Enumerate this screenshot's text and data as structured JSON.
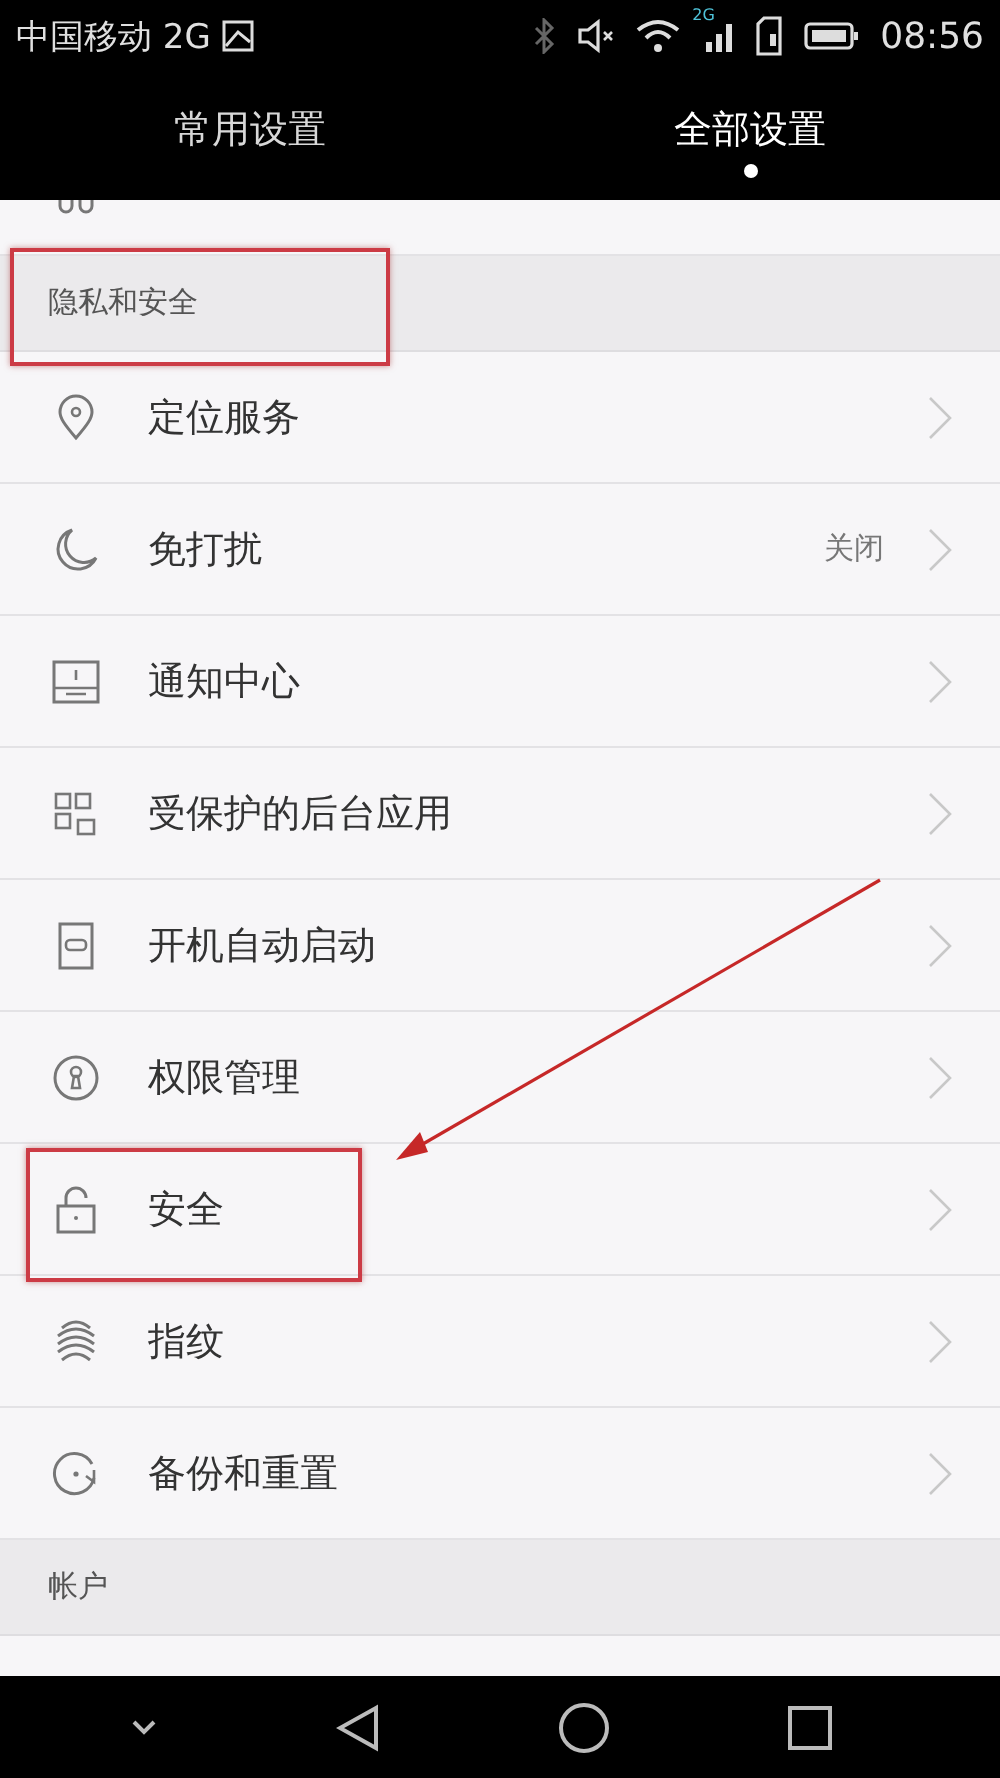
{
  "status_bar": {
    "carrier": "中国移动 2G",
    "network_badge": "2G",
    "time": "08:56"
  },
  "tabs": [
    {
      "label": "常用设置",
      "selected": false
    },
    {
      "label": "全部设置",
      "selected": true
    }
  ],
  "sections": [
    {
      "kind": "partial",
      "items": [
        {
          "kind": "steps"
        }
      ]
    },
    {
      "kind": "full",
      "title": "隐私和安全",
      "highlighted": true,
      "items": [
        {
          "kind": "location",
          "label": "定位服务",
          "highlighted": false
        },
        {
          "kind": "moon",
          "label": "免打扰",
          "value": "关闭",
          "highlighted": false
        },
        {
          "kind": "notification",
          "label": "通知中心",
          "highlighted": false
        },
        {
          "kind": "apps",
          "label": "受保护的后台应用",
          "highlighted": false
        },
        {
          "kind": "power",
          "label": "开机自动启动",
          "highlighted": false
        },
        {
          "kind": "keyhole",
          "label": "权限管理",
          "highlighted": false
        },
        {
          "kind": "lock",
          "label": "安全",
          "highlighted": true
        },
        {
          "kind": "fingerprint",
          "label": "指纹",
          "highlighted": false
        },
        {
          "kind": "backup",
          "label": "备份和重置",
          "highlighted": false
        }
      ]
    },
    {
      "kind": "full",
      "title": "帐户",
      "highlighted": false
    }
  ],
  "annotation_arrow": true
}
